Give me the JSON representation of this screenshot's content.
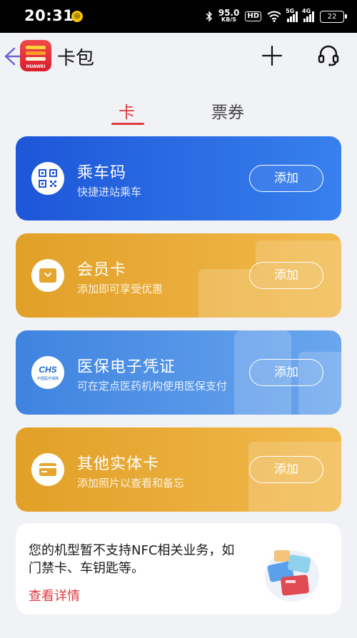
{
  "status_bar": {
    "time": "20:31",
    "net_speed": "95.0",
    "net_unit": "KB/S",
    "hd": "HD",
    "signal1": "5G",
    "signal2": "4G",
    "battery": "22"
  },
  "header": {
    "title": "卡包",
    "logo_text": "HUAWEI"
  },
  "tabs": [
    {
      "label": "卡",
      "active": true
    },
    {
      "label": "票券",
      "active": false
    }
  ],
  "cards": [
    {
      "title": "乘车码",
      "subtitle": "快捷进站乘车",
      "button": "添加",
      "icon": "qr-code-icon"
    },
    {
      "title": "会员卡",
      "subtitle": "添加即可享受优惠",
      "button": "添加",
      "icon": "member-card-icon"
    },
    {
      "title": "医保电子凭证",
      "subtitle": "可在定点医药机构使用医保支付",
      "button": "添加",
      "icon": "chs-logo-icon",
      "logo_text": "CHS",
      "logo_sub": "中国医疗保障"
    },
    {
      "title": "其他实体卡",
      "subtitle": "添加照片以查看和备忘",
      "button": "添加",
      "icon": "credit-card-icon"
    }
  ],
  "nfc_notice": {
    "message": "您的机型暂不支持NFC相关业务，如门禁卡、车钥匙等。",
    "link": "查看详情"
  },
  "colors": {
    "accent": "#e0393e",
    "transit_card": "#1d56d8",
    "member_card": "#e1a027",
    "medical_card": "#3f83e0",
    "other_card": "#e1a027"
  }
}
